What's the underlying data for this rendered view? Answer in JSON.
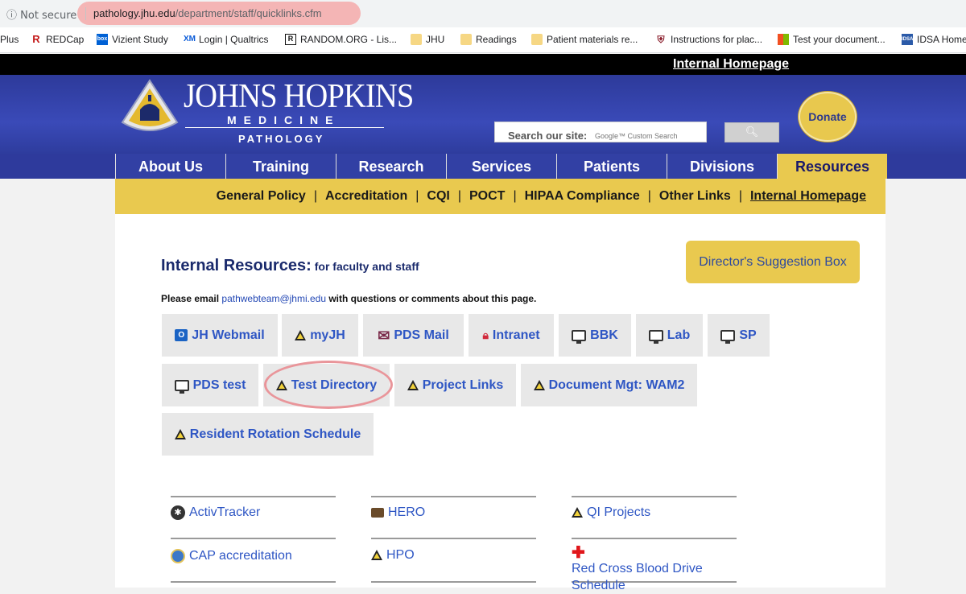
{
  "browser": {
    "security_label": "Not secure",
    "url_host": "pathology.jhu.edu",
    "url_path": "/department/staff/quicklinks.cfm",
    "bookmarks": [
      {
        "label": "Plus",
        "icon": "none"
      },
      {
        "label": "REDCap",
        "icon": "redcap-icon"
      },
      {
        "label": "Vizient Study",
        "icon": "box-icon"
      },
      {
        "label": "Login | Qualtrics",
        "icon": "qualtrics-icon"
      },
      {
        "label": "RANDOM.ORG - Lis...",
        "icon": "random-icon"
      },
      {
        "label": "JHU",
        "icon": "folder-icon"
      },
      {
        "label": "Readings",
        "icon": "folder-icon"
      },
      {
        "label": "Patient materials re...",
        "icon": "folder-icon"
      },
      {
        "label": "Instructions for plac...",
        "icon": "shield-icon"
      },
      {
        "label": "Test your document...",
        "icon": "microsoft-icon"
      },
      {
        "label": "IDSA Home",
        "icon": "idsa-icon"
      }
    ]
  },
  "topbar": {
    "internal_homepage": "Internal Homepage"
  },
  "header": {
    "logo_line1": "JOHNS HOPKINS",
    "logo_line2": "MEDICINE",
    "logo_line3": "PATHOLOGY",
    "search_label": "Search our site:",
    "search_placeholder": "Google™ Custom Search",
    "donate": "Donate",
    "colors": {
      "banner": "#2d3a9a",
      "gold": "#e9c94f",
      "link": "#2e56c4"
    }
  },
  "nav": {
    "tabs": [
      "About Us",
      "Training",
      "Research",
      "Services",
      "Patients",
      "Divisions",
      "Resources"
    ],
    "active": "Resources"
  },
  "subnav": {
    "links": [
      "General Policy",
      "Accreditation",
      "CQI",
      "POCT",
      "HIPAA Compliance",
      "Other Links",
      "Internal Homepage"
    ]
  },
  "main": {
    "title": "Internal Resources:",
    "subtitle": "for faculty and staff",
    "suggestion_box": "Director's Suggestion Box",
    "email_prefix": "Please email",
    "email_address": "pathwebteam@jhmi.edu",
    "email_suffix": "with questions or comments about this page.",
    "quick_buttons": [
      {
        "label": "JH Webmail",
        "icon": "outlook-icon"
      },
      {
        "label": "myJH",
        "icon": "warning-icon"
      },
      {
        "label": "PDS Mail",
        "icon": "envelope-icon"
      },
      {
        "label": "Intranet",
        "icon": "lock-icon"
      },
      {
        "label": "BBK",
        "icon": "monitor-icon"
      },
      {
        "label": "Lab",
        "icon": "monitor-icon"
      },
      {
        "label": "SP",
        "icon": "monitor-icon"
      },
      {
        "label": "PDS test",
        "icon": "monitor-icon"
      },
      {
        "label": "Test Directory",
        "icon": "warning-icon"
      },
      {
        "label": "Project Links",
        "icon": "warning-icon"
      },
      {
        "label": "Document Mgt: WAM2",
        "icon": "warning-icon"
      },
      {
        "label": "Resident Rotation Schedule",
        "icon": "warning-icon"
      }
    ],
    "link_list": [
      {
        "label": "ActivTracker",
        "icon": "activtracker-icon"
      },
      {
        "label": "HERO",
        "icon": "hero-icon"
      },
      {
        "label": "QI Projects",
        "icon": "warning-icon"
      },
      {
        "label": "CAP accreditation",
        "icon": "cap-icon"
      },
      {
        "label": "HPO",
        "icon": "warning-icon"
      },
      {
        "label": "Red Cross Blood Drive Schedule",
        "icon": "red-cross-icon"
      }
    ]
  }
}
